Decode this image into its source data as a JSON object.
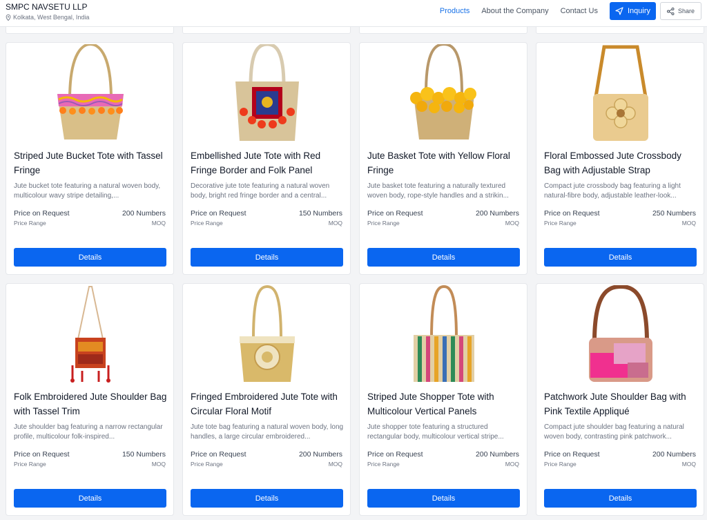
{
  "header": {
    "company_name": "SMPC NAVSETU LLP",
    "location": "Kolkata, West Bengal, India",
    "nav": [
      "Products",
      "About the Company",
      "Contact Us"
    ],
    "inquiry_label": "Inquiry",
    "share_label": "Share"
  },
  "colors": {
    "primary": "#0a66f0",
    "active_link": "#1a73e8"
  },
  "labels": {
    "price_range": "Price Range",
    "moq": "MOQ",
    "details": "Details"
  },
  "products": [
    {
      "title": "Striped Jute Bucket Tote with Tassel Fringe",
      "desc": "Jute bucket tote featuring a natural woven body, multicolour wavy stripe detailing,...",
      "price": "Price on Request",
      "moq": "200 Numbers"
    },
    {
      "title": "Embellished Jute Tote with Red Fringe Border and Folk Panel",
      "desc": "Decorative jute tote featuring a natural woven body, bright red fringe border and a central...",
      "price": "Price on Request",
      "moq": "150 Numbers"
    },
    {
      "title": "Jute Basket Tote with Yellow Floral Fringe",
      "desc": "Jute basket tote featuring a naturally textured woven body, rope-style handles and a strikin...",
      "price": "Price on Request",
      "moq": "200 Numbers"
    },
    {
      "title": "Floral Embossed Jute Crossbody Bag with Adjustable Strap",
      "desc": "Compact jute crossbody bag featuring a light natural-fibre body, adjustable leather-look...",
      "price": "Price on Request",
      "moq": "250 Numbers"
    },
    {
      "title": "Folk Embroidered Jute Shoulder Bag with Tassel Trim",
      "desc": "Jute shoulder bag featuring a narrow rectangular profile, multicolour folk-inspired...",
      "price": "Price on Request",
      "moq": "150 Numbers"
    },
    {
      "title": "Fringed Embroidered Jute Tote with Circular Floral Motif",
      "desc": "Jute tote bag featuring a natural woven body, long handles, a large circular embroidered...",
      "price": "Price on Request",
      "moq": "200 Numbers"
    },
    {
      "title": "Striped Jute Shopper Tote with Multicolour Vertical Panels",
      "desc": "Jute shopper tote featuring a structured rectangular body, multicolour vertical stripe...",
      "price": "Price on Request",
      "moq": "200 Numbers"
    },
    {
      "title": "Patchwork Jute Shoulder Bag with Pink Textile Appliqué",
      "desc": "Compact jute shoulder bag featuring a natural woven body, contrasting pink patchwork...",
      "price": "Price on Request",
      "moq": "200 Numbers"
    }
  ]
}
